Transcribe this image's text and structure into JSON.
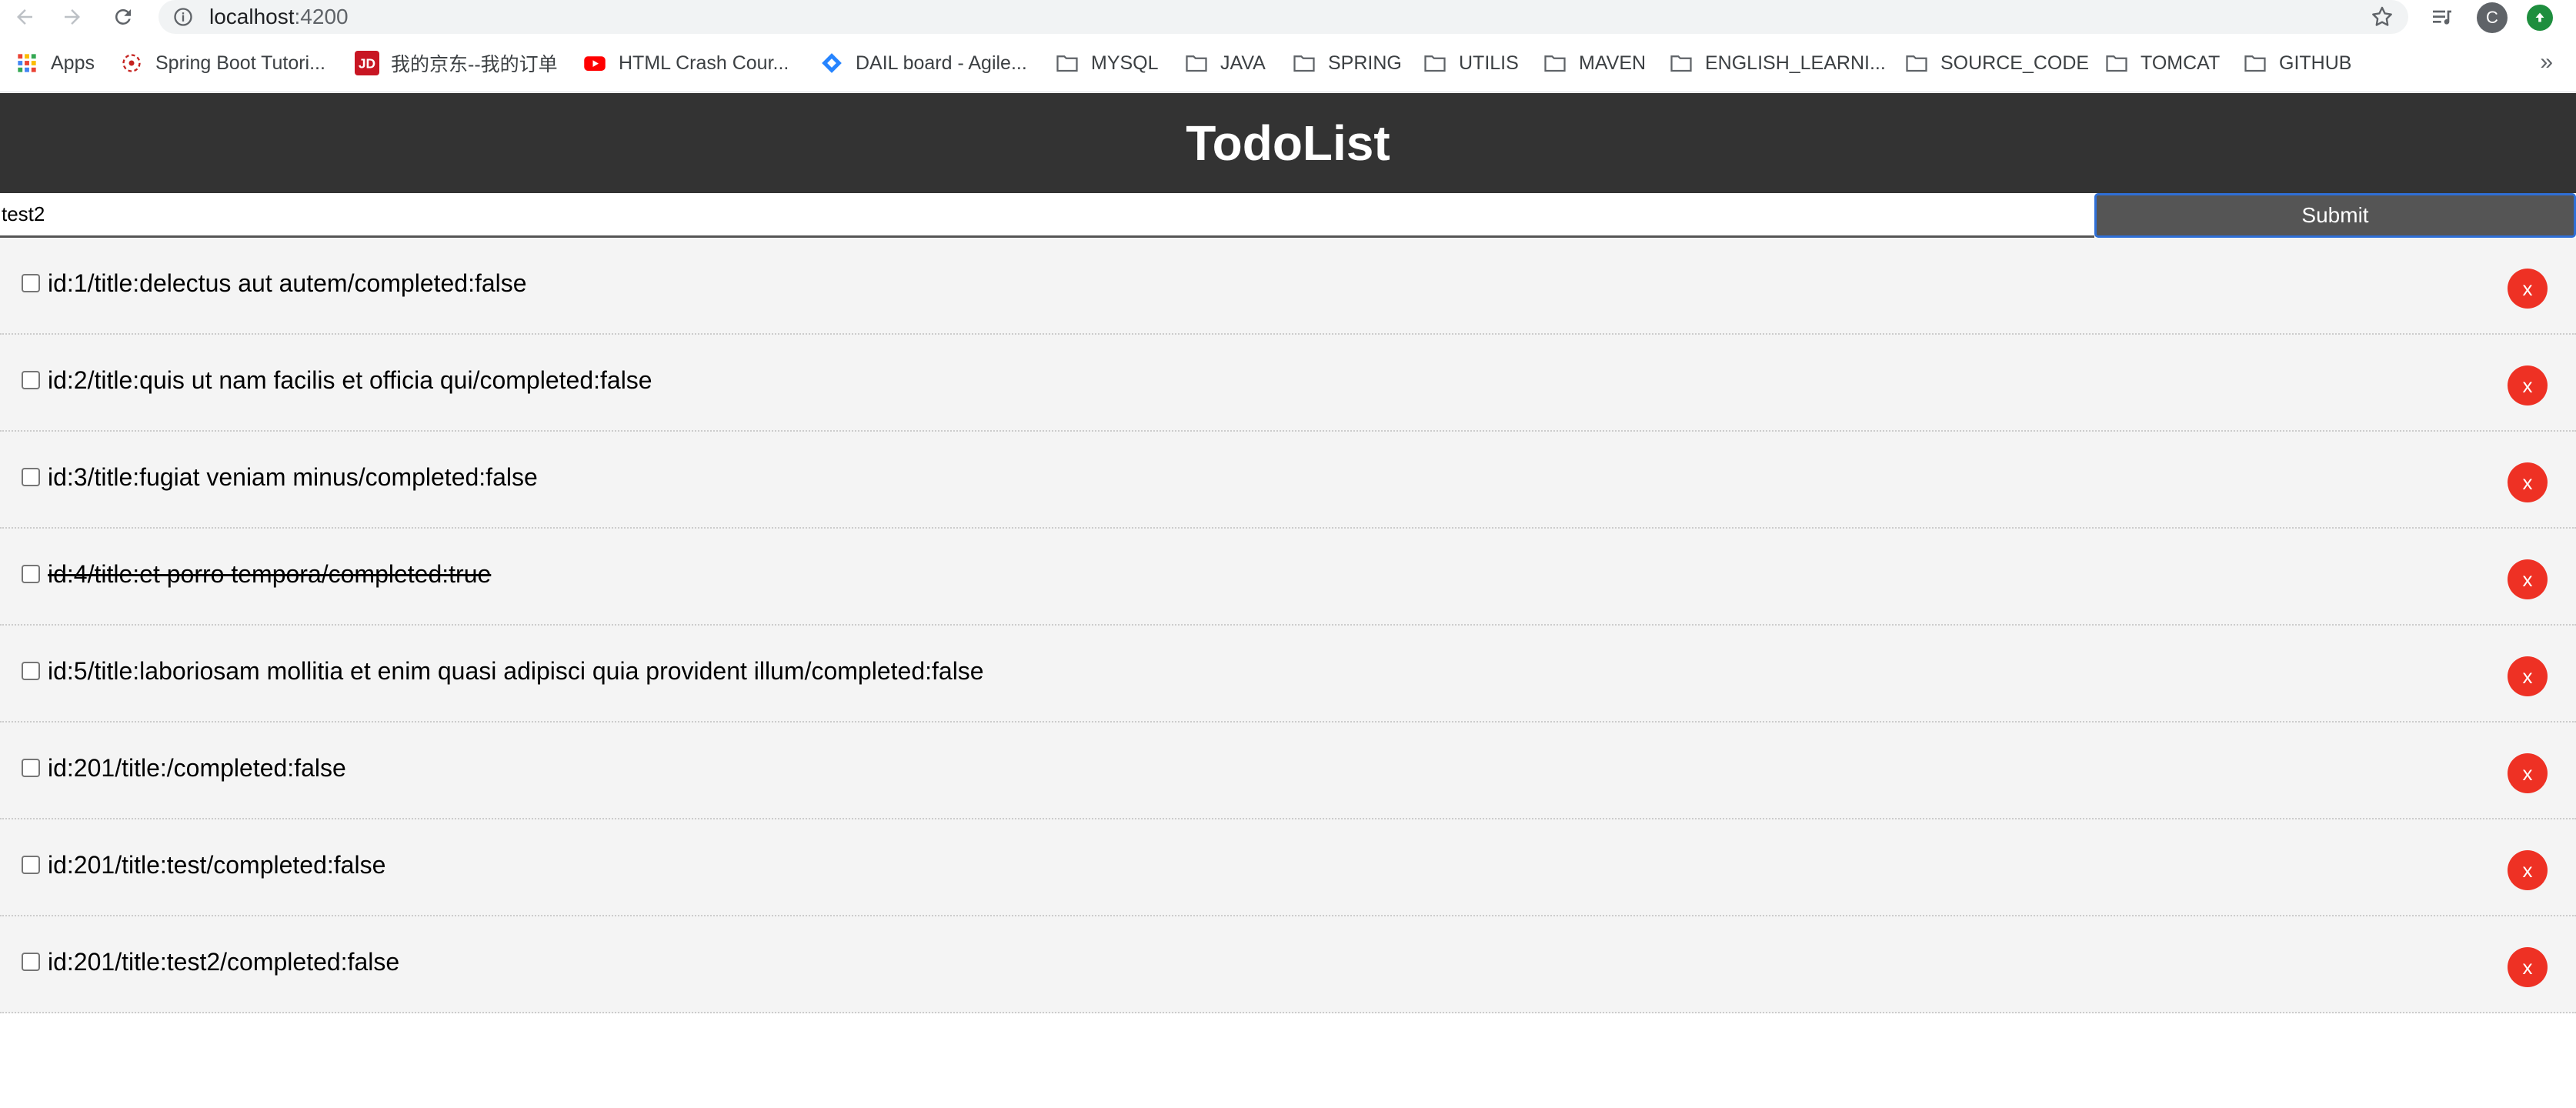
{
  "browser": {
    "url_host": "localhost",
    "url_port": ":4200",
    "avatar_letter": "C",
    "bookmarks": [
      {
        "label": "Apps",
        "icon": "apps-grid-icon"
      },
      {
        "label": "Spring Boot Tutori...",
        "icon": "site-favicon-icon"
      },
      {
        "label": "我的京东--我的订单",
        "icon": "jd-logo-icon"
      },
      {
        "label": "HTML Crash Cour...",
        "icon": "youtube-icon"
      },
      {
        "label": "DAIL board - Agile...",
        "icon": "jira-icon"
      },
      {
        "label": "MYSQL",
        "icon": "folder-icon"
      },
      {
        "label": "JAVA",
        "icon": "folder-icon"
      },
      {
        "label": "SPRING",
        "icon": "folder-icon"
      },
      {
        "label": "UTILIS",
        "icon": "folder-icon"
      },
      {
        "label": "MAVEN",
        "icon": "folder-icon"
      },
      {
        "label": "ENGLISH_LEARNI...",
        "icon": "folder-icon"
      },
      {
        "label": "SOURCE_CODE",
        "icon": "folder-icon"
      },
      {
        "label": "TOMCAT",
        "icon": "folder-icon"
      },
      {
        "label": "GITHUB",
        "icon": "folder-icon"
      }
    ],
    "more_bookmarks": "»"
  },
  "app": {
    "title": "TodoList",
    "input_value": "test2",
    "submit_label": "Submit",
    "delete_label": "x"
  },
  "todos": [
    {
      "text": "id:1/title:delectus aut autem/completed:false",
      "completed": false
    },
    {
      "text": "id:2/title:quis ut nam facilis et officia qui/completed:false",
      "completed": false
    },
    {
      "text": "id:3/title:fugiat veniam minus/completed:false",
      "completed": false
    },
    {
      "text": "id:4/title:et porro tempora/completed:true",
      "completed": true
    },
    {
      "text": "id:5/title:laboriosam mollitia et enim quasi adipisci quia provident illum/completed:false",
      "completed": false
    },
    {
      "text": "id:201/title:/completed:false",
      "completed": false
    },
    {
      "text": "id:201/title:test/completed:false",
      "completed": false
    },
    {
      "text": "id:201/title:test2/completed:false",
      "completed": false
    }
  ],
  "colors": {
    "header_bg": "#333333",
    "submit_bg": "#555555",
    "delete_bg": "#ee3124",
    "row_bg": "#f4f4f4"
  }
}
